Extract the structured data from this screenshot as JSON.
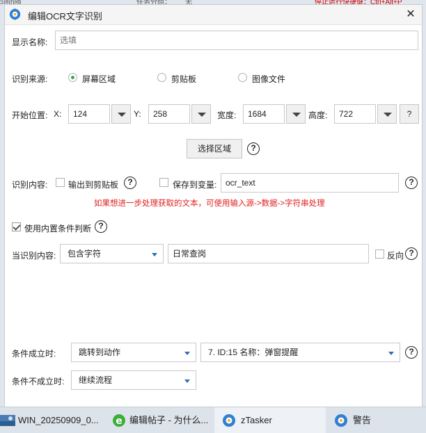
{
  "background": {
    "strip_left": "ɔ间ɦ隔",
    "strip_mid": "任务分组：",
    "strip_mid2": "无",
    "strip_right": "停止运行快捷键：Ctrl+Alt+P"
  },
  "dialog": {
    "title": "编辑OCR文字识别",
    "close_label": "✕",
    "display_name_label": "显示名称:",
    "display_name_placeholder": "选填",
    "source_label": "识别来源:",
    "source_options": [
      "屏幕区域",
      "剪贴板",
      "图像文件"
    ],
    "source_selected": "屏幕区域",
    "position_label": "开始位置:",
    "x_label": "X:",
    "x_value": "124",
    "y_label": "Y:",
    "y_value": "258",
    "width_label": "宽度:",
    "width_value": "1684",
    "height_label": "高度:",
    "height_value": "722",
    "help_q": "?",
    "select_area_button": "选择区域",
    "content_label": "识别内容:",
    "output_clipboard_label": "输出到剪贴板",
    "save_variable_label": "保存到变量:",
    "variable_value": "ocr_text",
    "hint_text": "如果想进一步处理获取的文本，可使用输入源->数据->字符串处理",
    "builtin_condition_label": "使用内置条件判断",
    "current_content_label": "当识别内容:",
    "match_mode": "包含字符",
    "match_text": "日常查岗",
    "reverse_label": "反向",
    "on_true_label": "条件成立时:",
    "on_true_action": "跳转到动作",
    "on_true_target": "7. ID:15 名称：弹窗提醒",
    "on_false_label": "条件不成立时:",
    "on_false_action": "继续流程"
  },
  "taskbar": {
    "items": [
      {
        "label": "WIN_20250909_0..."
      },
      {
        "label": "编辑帖子 - 为什么..."
      },
      {
        "label": "zTasker"
      },
      {
        "label": "警告"
      }
    ]
  },
  "colors": {
    "accent_green": "#3fa34d",
    "hint_red": "#e02020",
    "select_arrow_blue": "#2d6fb5",
    "taskbar": "#dde3ea"
  }
}
